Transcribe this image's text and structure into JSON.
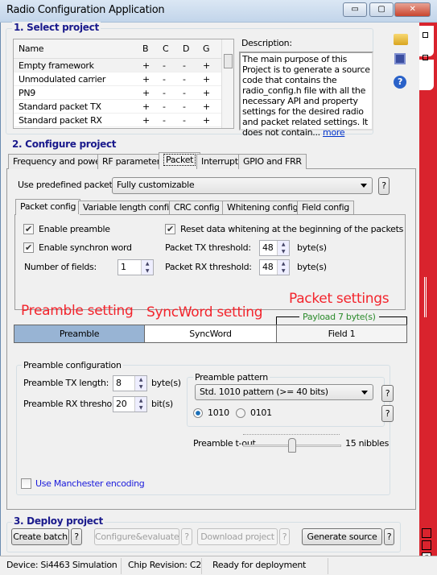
{
  "window": {
    "title": "Radio Configuration Application",
    "minimize": "▭",
    "maximize": "▢",
    "close": "✕"
  },
  "select_project": {
    "title": "1. Select project",
    "columns": [
      "Name",
      "B",
      "C",
      "D",
      "G"
    ],
    "rows": [
      [
        "Empty framework",
        "+",
        "-",
        "-",
        "+"
      ],
      [
        "Unmodulated carrier",
        "+",
        "-",
        "-",
        "+"
      ],
      [
        "PN9",
        "+",
        "-",
        "-",
        "+"
      ],
      [
        "Standard packet TX",
        "+",
        "-",
        "-",
        "+"
      ],
      [
        "Standard packet RX",
        "+",
        "-",
        "-",
        "+"
      ]
    ],
    "description_label": "Description:",
    "description": "The main purpose of this Project is to generate a source code that contains the radio_config.h file with all the necessary API and property settings for the desired radio and packet related settings. It does not contain...",
    "more_link": "more"
  },
  "toolbar": {
    "icons": [
      "open-folder-icon",
      "save-icon",
      "help-icon"
    ]
  },
  "configure": {
    "title": "2. Configure project",
    "tabs": [
      "Frequency and power",
      "RF parameters",
      "Packet",
      "Interrupts",
      "GPIO and FRR"
    ],
    "active_tab": "Packet",
    "predefined_label": "Use predefined packet:",
    "predefined_value": "Fully customizable",
    "help": "?",
    "inner_tabs": [
      "Packet config",
      "Variable length config",
      "CRC config",
      "Whitening config",
      "Field config"
    ],
    "enable_preamble": "Enable preamble",
    "enable_preamble_checked": true,
    "enable_sync": "Enable synchron word",
    "enable_sync_checked": true,
    "num_fields_label": "Number of fields:",
    "num_fields": "1",
    "reset_whitening": "Reset data whitening at the beginning of the packets",
    "reset_whitening_checked": true,
    "tx_threshold_label": "Packet TX threshold:",
    "tx_threshold": "48",
    "rx_threshold_label": "Packet RX threshold:",
    "rx_threshold": "48",
    "unit_bytes": "byte(s)"
  },
  "annotations": {
    "preamble": "Preamble setting",
    "syncword": "SyncWord setting",
    "packet": "Packet settings"
  },
  "segments": {
    "payload": "Payload 7 byte(s)",
    "items": [
      "Preamble",
      "SyncWord",
      "Field 1"
    ],
    "active": "Preamble"
  },
  "preamble_config": {
    "title": "Preamble configuration",
    "tx_length_label": "Preamble TX length:",
    "tx_length": "8",
    "tx_unit": "byte(s)",
    "rx_threshold_label": "Preamble RX threshold:",
    "rx_threshold": "20",
    "rx_unit": "bit(s)",
    "pattern_title": "Preamble pattern",
    "pattern_value": "Std. 1010 pattern (>= 40 bits)",
    "radio_1010": "1010",
    "radio_0101": "0101",
    "selected": "1010",
    "tout_label": "Preamble t-out",
    "tout_value": "15 nibbles",
    "tout_fraction": 0.5,
    "manchester": "Use Manchester encoding",
    "manchester_checked": false
  },
  "deploy": {
    "title": "3. Deploy project",
    "buttons": [
      "Create batch",
      "Configure&evaluate",
      "Download project",
      "Generate source"
    ],
    "help": "?"
  },
  "status": {
    "device": "Device: Si4463  Simulation",
    "chip": "Chip Revision: C2",
    "state": "Ready for deployment"
  },
  "colors": {
    "accent_red": "#d9232d",
    "section_blue": "#1a1a8c",
    "active_segment": "#98b4d4",
    "payload_green": "#2a8a2a"
  }
}
